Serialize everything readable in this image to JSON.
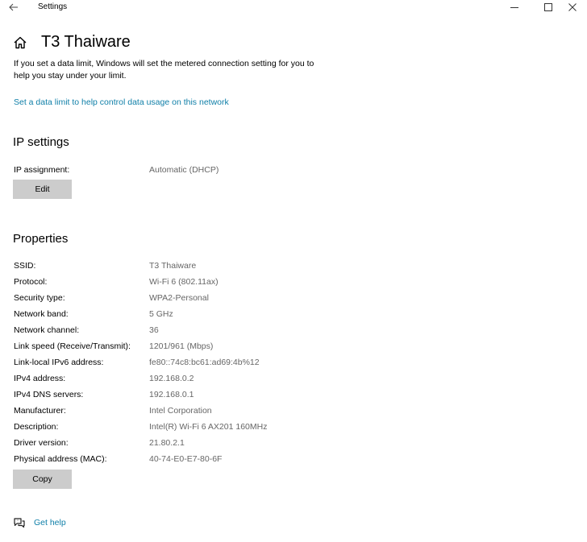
{
  "window": {
    "title": "Settings"
  },
  "header": {
    "title": "T3 Thaiware",
    "intro": "If you set a data limit, Windows will set the metered connection setting for you to help you stay under your limit.",
    "data_limit_link": "Set a data limit to help control data usage on this network"
  },
  "ip_settings": {
    "heading": "IP settings",
    "assignment_label": "IP assignment:",
    "assignment_value": "Automatic (DHCP)",
    "edit_label": "Edit"
  },
  "properties": {
    "heading": "Properties",
    "rows": [
      {
        "label": "SSID:",
        "value": "T3 Thaiware"
      },
      {
        "label": "Protocol:",
        "value": "Wi-Fi 6 (802.11ax)"
      },
      {
        "label": "Security type:",
        "value": "WPA2-Personal"
      },
      {
        "label": "Network band:",
        "value": "5 GHz"
      },
      {
        "label": "Network channel:",
        "value": "36"
      },
      {
        "label": "Link speed (Receive/Transmit):",
        "value": "1201/961 (Mbps)"
      },
      {
        "label": "Link-local IPv6 address:",
        "value": "fe80::74c8:bc61:ad69:4b%12"
      },
      {
        "label": "IPv4 address:",
        "value": "192.168.0.2"
      },
      {
        "label": "IPv4 DNS servers:",
        "value": "192.168.0.1"
      },
      {
        "label": "Manufacturer:",
        "value": "Intel Corporation"
      },
      {
        "label": "Description:",
        "value": "Intel(R) Wi-Fi 6 AX201 160MHz"
      },
      {
        "label": "Driver version:",
        "value": "21.80.2.1"
      },
      {
        "label": "Physical address (MAC):",
        "value": "40-74-E0-E7-80-6F"
      }
    ],
    "copy_label": "Copy"
  },
  "footer": {
    "help_label": "Get help"
  },
  "colors": {
    "link": "#0f7fa8",
    "value_text": "#666666",
    "button_bg": "#cccccc"
  },
  "icons": {
    "back": "arrow-left-icon",
    "home": "home-icon",
    "help": "help-chat-icon",
    "minimize": "minimize-icon",
    "maximize": "maximize-icon",
    "close": "close-icon"
  }
}
